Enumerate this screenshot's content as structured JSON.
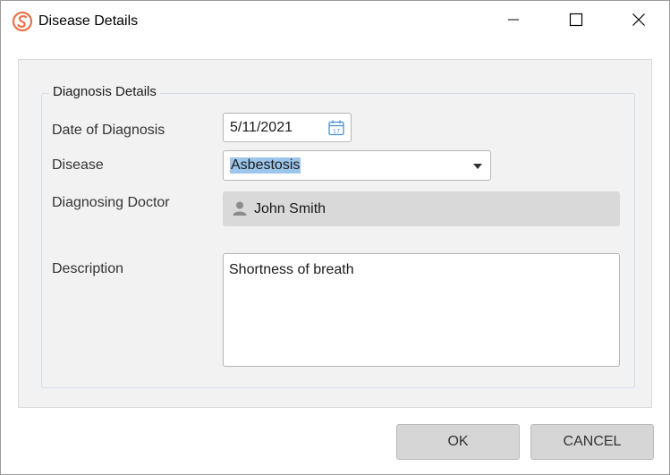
{
  "window": {
    "title": "Disease Details"
  },
  "group": {
    "title": "Diagnosis Details"
  },
  "fields": {
    "date_label": "Date of Diagnosis",
    "date_value": "5/11/2021",
    "disease_label": "Disease",
    "disease_value": "Asbestosis",
    "doctor_label": "Diagnosing Doctor",
    "doctor_value": "John Smith",
    "description_label": "Description",
    "description_value": "Shortness of breath"
  },
  "buttons": {
    "ok": "OK",
    "cancel": "CANCEL"
  },
  "icons": {
    "app": "app-logo-icon",
    "calendar": "calendar-icon",
    "person": "person-icon",
    "minimize": "minimize-icon",
    "maximize": "maximize-icon",
    "close": "close-icon",
    "dropdown": "chevron-down-icon"
  },
  "colors": {
    "accent": "#e8734a",
    "selection": "#9cc6ec",
    "calendar_icon": "#4a8fd6"
  }
}
